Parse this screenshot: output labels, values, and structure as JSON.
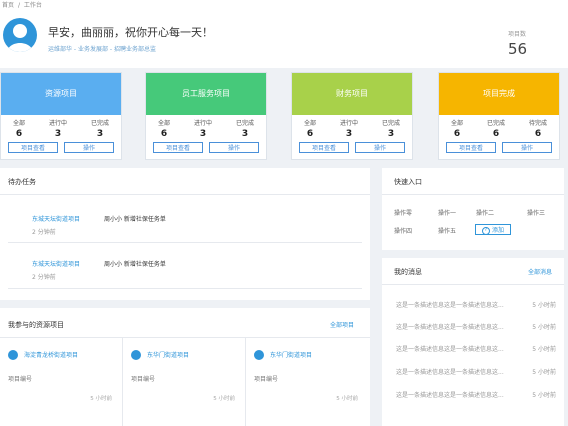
{
  "breadcrumb": {
    "home": "首页",
    "sep": "/",
    "current": "工作台"
  },
  "header": {
    "greeting": "早安，曲丽丽，祝你开心每一天！",
    "role": "运维部华 - 业务发展部 - 招聘业务部总监",
    "project_label": "项目数",
    "project_count": "56"
  },
  "cards": [
    {
      "title": "资源项目",
      "color": "#5aaef0",
      "stats": [
        {
          "label": "全部",
          "value": "6"
        },
        {
          "label": "进行中",
          "value": "3"
        },
        {
          "label": "已完成",
          "value": "3"
        }
      ],
      "btn1": "项目查看",
      "btn2": "操作"
    },
    {
      "title": "员工服务项目",
      "color": "#46c97a",
      "stats": [
        {
          "label": "全部",
          "value": "6"
        },
        {
          "label": "进行中",
          "value": "3"
        },
        {
          "label": "已完成",
          "value": "3"
        }
      ],
      "btn1": "项目查看",
      "btn2": "操作"
    },
    {
      "title": "财务项目",
      "color": "#a8d14a",
      "stats": [
        {
          "label": "全部",
          "value": "6"
        },
        {
          "label": "进行中",
          "value": "3"
        },
        {
          "label": "已完成",
          "value": "3"
        }
      ],
      "btn1": "项目查看",
      "btn2": "操作"
    },
    {
      "title": "项目完成",
      "color": "#f6b500",
      "stats": [
        {
          "label": "全部",
          "value": "6"
        },
        {
          "label": "已完成",
          "value": "6"
        },
        {
          "label": "待完成",
          "value": "6"
        }
      ],
      "btn1": "项目查看",
      "btn2": "操作"
    }
  ],
  "tasks": {
    "title": "待办任务",
    "items": [
      {
        "project": "东城天坛街道项目",
        "name": "周小小 新增社保任务单",
        "time": "2 分钟前"
      },
      {
        "project": "东城天坛街道项目",
        "name": "周小小 新增社保任务单",
        "time": "2 分钟前"
      }
    ]
  },
  "quick": {
    "title": "快速入口",
    "items": [
      "操作零",
      "操作一",
      "操作二",
      "操作三",
      "操作四",
      "操作五"
    ],
    "add_label": "添加"
  },
  "messages": {
    "title": "我的消息",
    "all_label": "全部消息",
    "items": [
      {
        "text": "这是一条描述信息这是一条描述信息这...",
        "time": "5 小时前"
      },
      {
        "text": "这是一条描述信息这是一条描述信息这...",
        "time": "5 小时前"
      },
      {
        "text": "这是一条描述信息这是一条描述信息这...",
        "time": "5 小时前"
      },
      {
        "text": "这是一条描述信息这是一条描述信息这...",
        "time": "5 小时前"
      },
      {
        "text": "这是一条描述信息这是一条描述信息这...",
        "time": "5 小时前"
      }
    ]
  },
  "my_projects": {
    "title": "我参与的资源项目",
    "all_label": "全部项目",
    "items": [
      {
        "title": "海淀青龙桥街道项目",
        "no": "项目编号",
        "time": "5 小时前"
      },
      {
        "title": "东华门街道项目",
        "no": "项目编号",
        "time": "5 小时前"
      },
      {
        "title": "东华门街道项目",
        "no": "项目编号",
        "time": "5 小时前"
      }
    ]
  },
  "colors": {
    "accent": "#2f95d9"
  }
}
